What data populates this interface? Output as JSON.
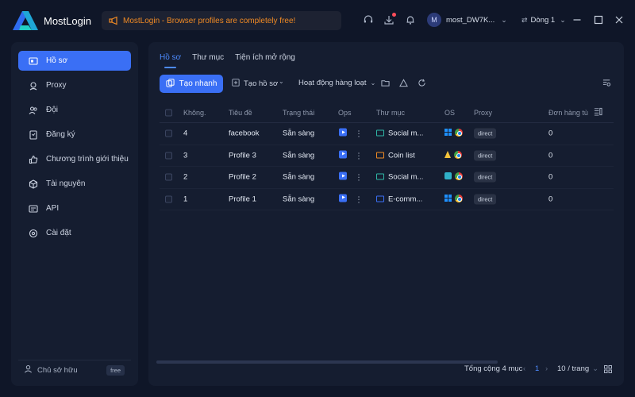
{
  "app": {
    "name": "MostLogin",
    "notice": "MostLogin - Browser profiles are completely free!",
    "user": "most_DW7K...",
    "avatar_letter": "M",
    "team": "Dòng 1"
  },
  "sidebar": {
    "items": [
      {
        "label": "Hồ sơ",
        "icon": "profile-card-icon",
        "active": true
      },
      {
        "label": "Proxy",
        "icon": "location-pin-icon"
      },
      {
        "label": "Đội",
        "icon": "team-icon"
      },
      {
        "label": "Đăng ký",
        "icon": "bookmark-icon"
      },
      {
        "label": "Chương trình giới thiệu",
        "icon": "thumbs-up-icon"
      },
      {
        "label": "Tài nguyên",
        "icon": "cube-icon"
      },
      {
        "label": "API",
        "icon": "api-icon"
      },
      {
        "label": "Cài đặt",
        "icon": "gear-icon"
      }
    ],
    "owner_label": "Chủ sở hữu",
    "plan_badge": "free"
  },
  "tabs": [
    {
      "label": "Hồ sơ",
      "active": true
    },
    {
      "label": "Thư mục"
    },
    {
      "label": "Tiện ích mở rộng"
    }
  ],
  "toolbar": {
    "quick_create": "Tạo nhanh",
    "create_profile": "Tạo hồ sơ",
    "batch_actions": "Hoạt động hàng loạt"
  },
  "table": {
    "headers": {
      "no": "Không.",
      "title": "Tiêu đề",
      "status": "Trạng thái",
      "ops": "Ops",
      "folder": "Thư mục",
      "os": "OS",
      "proxy": "Proxy",
      "order": "Đơn hàng tùy"
    },
    "rows": [
      {
        "no": "4",
        "title": "facebook",
        "status": "Sẵn sàng",
        "folder": "Social m...",
        "folder_color": "#2fb8a6",
        "os": "windows",
        "proxy": "direct",
        "order": "0"
      },
      {
        "no": "3",
        "title": "Profile 3",
        "status": "Sẵn sàng",
        "folder": "Coin list",
        "folder_color": "#f08a24",
        "os": "linux",
        "proxy": "direct",
        "order": "0"
      },
      {
        "no": "2",
        "title": "Profile 2",
        "status": "Sẵn sàng",
        "folder": "Social m...",
        "folder_color": "#2fb8a6",
        "os": "macos",
        "proxy": "direct",
        "order": "0"
      },
      {
        "no": "1",
        "title": "Profile 1",
        "status": "Sẵn sàng",
        "folder": "E-comm...",
        "folder_color": "#3a6ff5",
        "os": "windows",
        "proxy": "direct",
        "order": "0"
      }
    ]
  },
  "footer": {
    "total": "Tổng cộng 4 mục",
    "page": "1",
    "per_page": "10 / trang"
  },
  "colors": {
    "accent": "#3a6ff5",
    "notice": "#f08a24",
    "background": "#0f1628",
    "panel": "#151d30"
  }
}
